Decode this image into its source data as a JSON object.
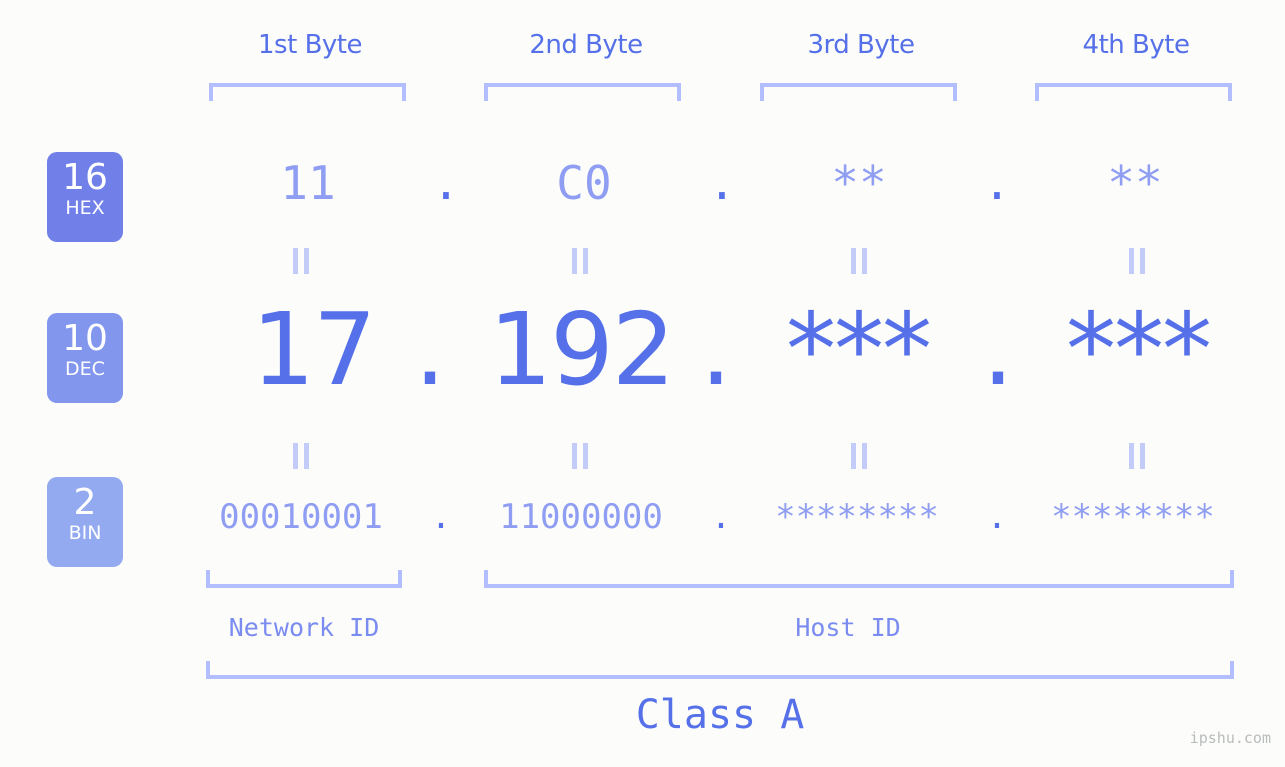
{
  "background_color": "#fcfdfa",
  "accent_color": "#5570e8",
  "muted_accent_color": "#8f9df2",
  "bracket_color": "#b2beff",
  "byte_headers": [
    {
      "label": "1st Byte"
    },
    {
      "label": "2nd Byte"
    },
    {
      "label": "3rd Byte"
    },
    {
      "label": "4th Byte"
    }
  ],
  "bases": [
    {
      "number": "16",
      "name": "HEX",
      "color": "#7080e8"
    },
    {
      "number": "10",
      "name": "DEC",
      "color": "#8296ee"
    },
    {
      "number": "2",
      "name": "BIN",
      "color": "#93aaf0"
    }
  ],
  "rows": {
    "hex": {
      "base_number": "16",
      "base_name": "HEX",
      "values": [
        "11",
        "C0",
        "**",
        "**"
      ],
      "separator": "."
    },
    "dec": {
      "base_number": "10",
      "base_name": "DEC",
      "values": [
        "17",
        "192",
        "***",
        "***"
      ],
      "separator": "."
    },
    "bin": {
      "base_number": "2",
      "base_name": "BIN",
      "values": [
        "00010001",
        "11000000",
        "********",
        "********"
      ],
      "separator": "."
    }
  },
  "equals_marks": {
    "glyph": "||",
    "count_per_row": 4,
    "rows": 2
  },
  "id_sections": [
    {
      "label": "Network ID",
      "bytes": 1
    },
    {
      "label": "Host ID",
      "bytes": 3
    }
  ],
  "class_label": "Class A",
  "watermark": "ipshu.com"
}
